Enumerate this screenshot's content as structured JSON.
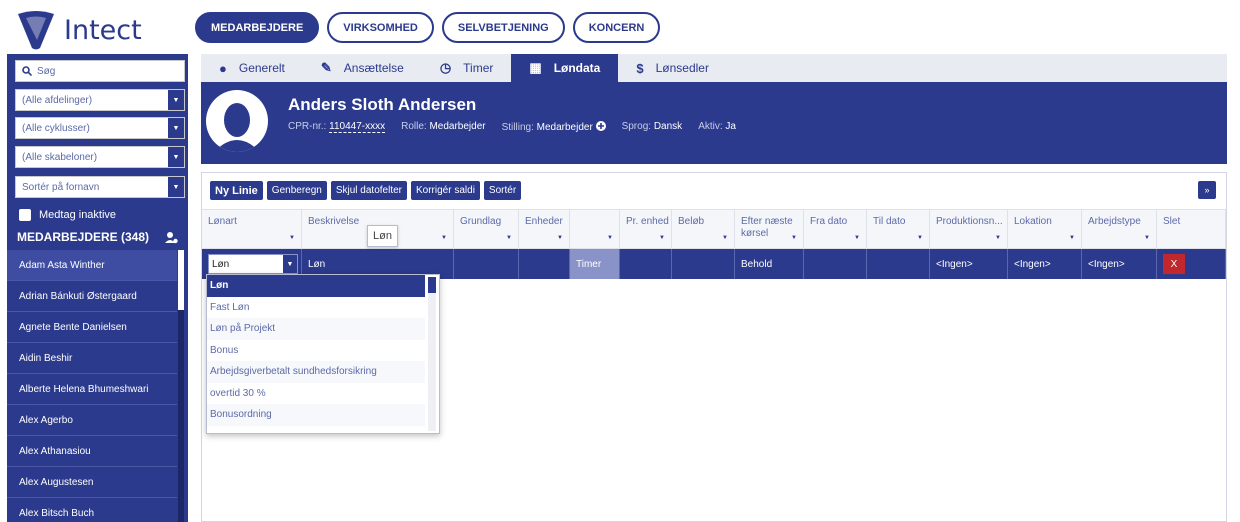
{
  "app": {
    "logo_text": "Intect"
  },
  "topnav": [
    "MEDARBEJDERE",
    "VIRKSOMHED",
    "SELVBETJENING",
    "KONCERN"
  ],
  "sidebar": {
    "search_placeholder": "Søg",
    "filters": [
      "(Alle afdelinger)",
      "(Alle cyklusser)",
      "(Alle skabeloner)",
      "Sortér på fornavn"
    ],
    "include_inactive_label": "Medtag inaktive",
    "list_title": "MEDARBEJDERE (348)",
    "employees": [
      "Adam Asta Winther",
      "Adrian Bánkuti Østergaard",
      "Agnete Bente Danielsen",
      "Aidin Beshir",
      "Alberte Helena Bhumeshwari",
      "Alex Agerbo",
      "Alex Athanasiou",
      "Alex Augustesen",
      "Alex Bitsch Buch"
    ]
  },
  "employee_tabs": [
    {
      "label": "Generelt",
      "icon": "person-icon",
      "glyph": "●"
    },
    {
      "label": "Ansættelse",
      "icon": "edit-document-icon",
      "glyph": "✎"
    },
    {
      "label": "Timer",
      "icon": "clock-icon",
      "glyph": "◷"
    },
    {
      "label": "Løndata",
      "icon": "table-icon",
      "glyph": "▦"
    },
    {
      "label": "Lønsedler",
      "icon": "dollar-icon",
      "glyph": "$"
    }
  ],
  "profile": {
    "name": "Anders Sloth Andersen",
    "cpr_label": "CPR-nr.:",
    "cpr_value": "110447-xxxx",
    "role_label": "Rolle:",
    "role_value": "Medarbejder",
    "position_label": "Stilling:",
    "position_value": "Medarbejder",
    "language_label": "Sprog:",
    "language_value": "Dansk",
    "active_label": "Aktiv:",
    "active_value": "Ja"
  },
  "toolbar": {
    "new_line": "Ny Linie",
    "recalculate": "Genberegn",
    "hide_date_fields": "Skjul datofelter",
    "correct_balances": "Korrigér saldi",
    "sort": "Sortér",
    "expand": "»"
  },
  "grid": {
    "columns": [
      "Lønart",
      "Beskrivelse",
      "Grundlag",
      "Enheder",
      "",
      "Pr. enhed",
      "Beløb",
      "Efter næste kørsel",
      "Fra dato",
      "Til dato",
      "Produktionsn...",
      "Lokation",
      "Arbejdstype",
      "Slet"
    ],
    "row": {
      "type": "Løn",
      "description": "Løn",
      "unit_type": "Timer",
      "after_next_run": "Behold",
      "production": "<Ingen>",
      "location": "<Ingen>",
      "work_type": "<Ingen>",
      "delete": "X"
    },
    "tooltip": "Løn"
  },
  "dropdown": {
    "options": [
      "Løn",
      "Fast Løn",
      "Løn på Projekt",
      "Bonus",
      "Arbejdsgiverbetalt sundhedsforsikring",
      "overtid 30 %",
      "Bonusordning"
    ]
  },
  "colors": {
    "brand": "#2b3a8c",
    "delete": "#c0282d"
  }
}
